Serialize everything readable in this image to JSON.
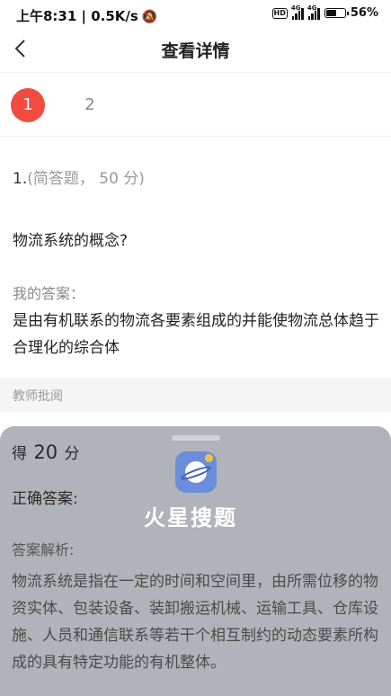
{
  "status_bar": {
    "time_speed": "上午8:31 | 0.5K/s",
    "hd": "HD",
    "net1": "4G",
    "net2": "4G",
    "battery_percent": "56%",
    "battery_level": 0.56
  },
  "header": {
    "title": "查看详情"
  },
  "pager": {
    "pages": [
      "1",
      "2"
    ],
    "active": "1"
  },
  "question": {
    "number": "1.",
    "type": "(简答题， 50 分)",
    "text": "物流系统的概念?"
  },
  "my_answer": {
    "label": "我的答案：",
    "text": "是由有机联系的物流各要素组成的并能使物流总体趋于合理化的综合体"
  },
  "review": {
    "label": "教师批阅"
  },
  "result": {
    "score_prefix": "得",
    "score_value": "20",
    "score_suffix": "分",
    "correct_label": "正确答案:",
    "analysis_label": "答案解析:",
    "analysis_text": "物流系统是指在一定的时间和空间里，由所需位移的物资实体、包装设备、装卸搬运机械、运输工具、仓库设施、人员和通信联系等若干个相互制约的动态要素所构成的具有特定功能的有机整体。"
  },
  "watermark": {
    "brand": "火星搜题",
    "icon": "planet-logo-icon"
  }
}
